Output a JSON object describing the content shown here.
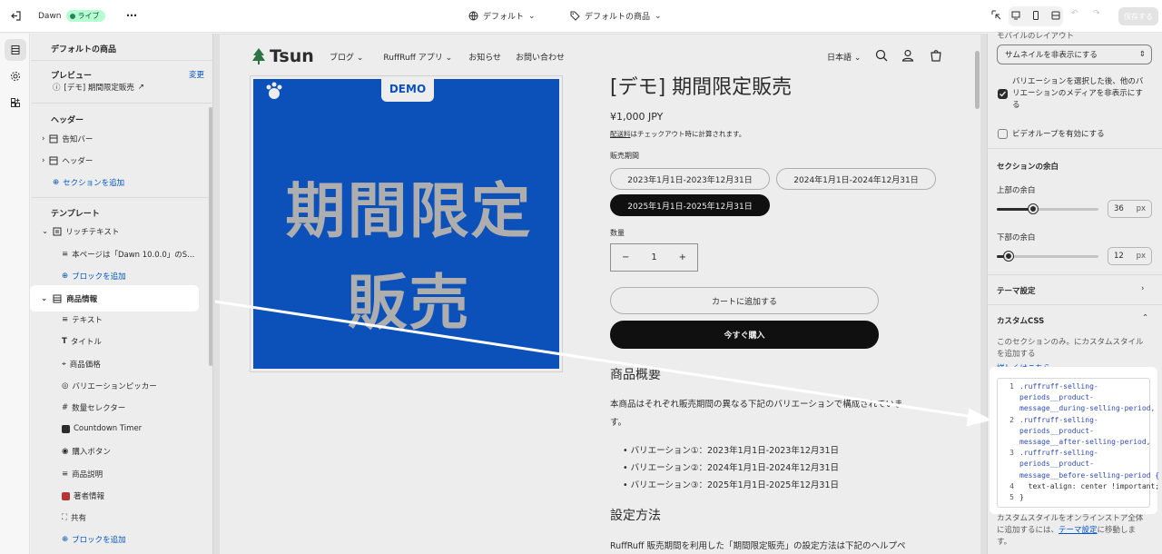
{
  "topbar": {
    "theme_name": "Dawn",
    "live_label": "ライブ",
    "template_select": "デフォルト",
    "product_select": "デフォルトの商品",
    "save_label": "保存する"
  },
  "sidebar": {
    "title": "デフォルトの商品",
    "preview_label": "プレビュー",
    "change_label": "変更",
    "preview_product": "[デモ] 期間限定販売",
    "header_group": "ヘッダー",
    "header_items": [
      "告知バー",
      "ヘッダー"
    ],
    "add_section": "セクションを追加",
    "template_group": "テンプレート",
    "rich_text": "リッチテキスト",
    "rich_text_child": "本ページは「Dawn 10.0.0」のS...",
    "add_block": "ブロックを追加",
    "product_info": "商品情報",
    "product_blocks": [
      "テキスト",
      "タイトル",
      "商品価格",
      "バリエーションピッカー",
      "数量セレクター",
      "Countdown Timer",
      "購入ボタン",
      "商品説明",
      "著者情報",
      "共有"
    ],
    "add_block_2": "ブロックを追加"
  },
  "store": {
    "logo": "Tsun",
    "nav": [
      "ブログ",
      "RuffRuff アプリ",
      "お知らせ",
      "お問い合わせ"
    ],
    "language": "日本語",
    "image_demo": "DEMO",
    "image_line1": "期間限定",
    "image_line2": "販売",
    "product_title": "[デモ] 期間限定販売",
    "price": "¥1,000 JPY",
    "shipping_link": "配送料",
    "shipping_note": "はチェックアウト時に計算されます。",
    "variant_label": "販売期間",
    "variants": [
      "2023年1月1日-2023年12月31日",
      "2024年1月1日-2024年12月31日",
      "2025年1月1日-2025年12月31日"
    ],
    "qty_label": "数量",
    "qty_value": "1",
    "add_to_cart": "カートに追加する",
    "buy_now": "今すぐ購入",
    "overview_heading": "商品概要",
    "overview_text": "本商品はそれぞれ販売期間の異なる下記のバリエーションで構成されていま",
    "overview_text2": "す。",
    "bullets": [
      "バリエーション①：2023年1月1日-2023年12月31日",
      "バリエーション②：2024年1月1日-2024年12月31日",
      "バリエーション③：2025年1月1日-2025年12月31日"
    ],
    "setup_heading": "設定方法",
    "setup_text": "RuffRuff 販売期間を利用した「期間限定販売」の設定方法は下記のヘルプペ"
  },
  "right_panel": {
    "mobile_layout_label": "モバイルのレイアウト",
    "mobile_layout_value": "サムネイルを非表示にする",
    "hide_media_label": "バリエーションを選択した後、他のバリエーションのメディアを非表示にする",
    "hide_media_checked": true,
    "video_loop_label": "ビデオループを有効にする",
    "video_loop_checked": false,
    "padding_heading": "セクションの余白",
    "top_padding_label": "上部の余白",
    "top_padding_value": "36",
    "top_padding_fraction": 0.36,
    "bottom_padding_label": "下部の余白",
    "bottom_padding_value": "12",
    "bottom_padding_fraction": 0.12,
    "unit": "px",
    "theme_settings": "テーマ設定",
    "custom_css_heading": "カスタムCSS",
    "custom_css_desc1": "このセクションのみ。にカスタムスタイル",
    "custom_css_desc2": "を追加する",
    "learn_more": "詳しくはこちら",
    "footer_text1": "カスタムスタイルをオンラインストア全体",
    "footer_text2a": "に追加するには、",
    "footer_link": "テーマ設定",
    "footer_text2b": "に移動しま",
    "footer_text3": "す。",
    "code_lines": [
      {
        "n": "1",
        "text": ".ruffruff-selling-"
      },
      {
        "n": "",
        "text": "periods__product-"
      },
      {
        "n": "",
        "text": "message__during-selling-period,"
      },
      {
        "n": "2",
        "text": ".ruffruff-selling-"
      },
      {
        "n": "",
        "text": "periods__product-"
      },
      {
        "n": "",
        "text": "message__after-selling-period,"
      },
      {
        "n": "3",
        "text": ".ruffruff-selling-"
      },
      {
        "n": "",
        "text": "periods__product-"
      },
      {
        "n": "",
        "text": "message__before-selling-period {"
      },
      {
        "n": "4",
        "text": "  text-align: center !important;"
      },
      {
        "n": "5",
        "text": "}"
      }
    ]
  }
}
